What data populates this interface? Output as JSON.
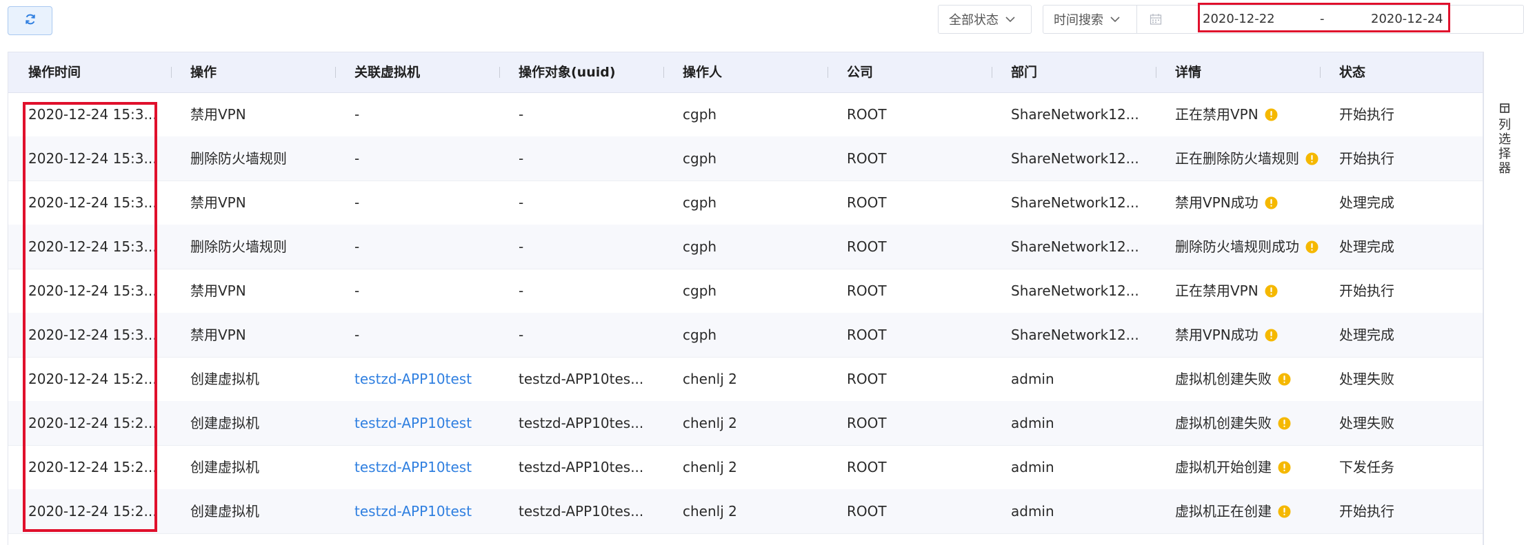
{
  "toolbar": {
    "status_filter": "全部状态",
    "time_filter": "时间搜索",
    "date_start": "2020-12-22",
    "date_separator": "-",
    "date_end": "2020-12-24"
  },
  "columns": [
    "操作时间",
    "操作",
    "关联虚拟机",
    "操作对象(uuid)",
    "操作人",
    "公司",
    "部门",
    "详情",
    "状态"
  ],
  "rows": [
    {
      "time": "2020-12-24 15:3...",
      "action": "禁用VPN",
      "vm": "-",
      "target": "-",
      "operator": "cgph",
      "company": "ROOT",
      "dept": "ShareNetwork12...",
      "detail": "正在禁用VPN",
      "status": "开始执行"
    },
    {
      "time": "2020-12-24 15:3...",
      "action": "删除防火墙规则",
      "vm": "-",
      "target": "-",
      "operator": "cgph",
      "company": "ROOT",
      "dept": "ShareNetwork12...",
      "detail": "正在删除防火墙规则",
      "status": "开始执行"
    },
    {
      "time": "2020-12-24 15:3...",
      "action": "禁用VPN",
      "vm": "-",
      "target": "-",
      "operator": "cgph",
      "company": "ROOT",
      "dept": "ShareNetwork12...",
      "detail": "禁用VPN成功",
      "status": "处理完成"
    },
    {
      "time": "2020-12-24 15:3...",
      "action": "删除防火墙规则",
      "vm": "-",
      "target": "-",
      "operator": "cgph",
      "company": "ROOT",
      "dept": "ShareNetwork12...",
      "detail": "删除防火墙规则成功",
      "status": "处理完成"
    },
    {
      "time": "2020-12-24 15:3...",
      "action": "禁用VPN",
      "vm": "-",
      "target": "-",
      "operator": "cgph",
      "company": "ROOT",
      "dept": "ShareNetwork12...",
      "detail": "正在禁用VPN",
      "status": "开始执行"
    },
    {
      "time": "2020-12-24 15:3...",
      "action": "禁用VPN",
      "vm": "-",
      "target": "-",
      "operator": "cgph",
      "company": "ROOT",
      "dept": "ShareNetwork12...",
      "detail": "禁用VPN成功",
      "status": "处理完成"
    },
    {
      "time": "2020-12-24 15:2...",
      "action": "创建虚拟机",
      "vm": "testzd-APP10test",
      "target": "testzd-APP10tes...",
      "operator": "chenlj 2",
      "company": "ROOT",
      "dept": "admin",
      "detail": "虚拟机创建失败",
      "status": "处理失败"
    },
    {
      "time": "2020-12-24 15:2...",
      "action": "创建虚拟机",
      "vm": "testzd-APP10test",
      "target": "testzd-APP10tes...",
      "operator": "chenlj 2",
      "company": "ROOT",
      "dept": "admin",
      "detail": "虚拟机创建失败",
      "status": "处理失败"
    },
    {
      "time": "2020-12-24 15:2...",
      "action": "创建虚拟机",
      "vm": "testzd-APP10test",
      "target": "testzd-APP10tes...",
      "operator": "chenlj 2",
      "company": "ROOT",
      "dept": "admin",
      "detail": "虚拟机开始创建",
      "status": "下发任务"
    },
    {
      "time": "2020-12-24 15:2...",
      "action": "创建虚拟机",
      "vm": "testzd-APP10test",
      "target": "testzd-APP10tes...",
      "operator": "chenlj 2",
      "company": "ROOT",
      "dept": "admin",
      "detail": "虚拟机正在创建",
      "status": "开始执行"
    }
  ],
  "column_chooser": {
    "label": "列选择器"
  },
  "icons": {
    "refresh": "refresh-icon",
    "dropdown": "chevron-down-icon",
    "calendar": "calendar-icon",
    "warning": "warning-icon",
    "columns": "columns-icon"
  },
  "colors": {
    "accent": "#2f7fe0",
    "warning": "#f5b800",
    "highlight": "#e0102c",
    "header_bg": "#eef1fb"
  }
}
